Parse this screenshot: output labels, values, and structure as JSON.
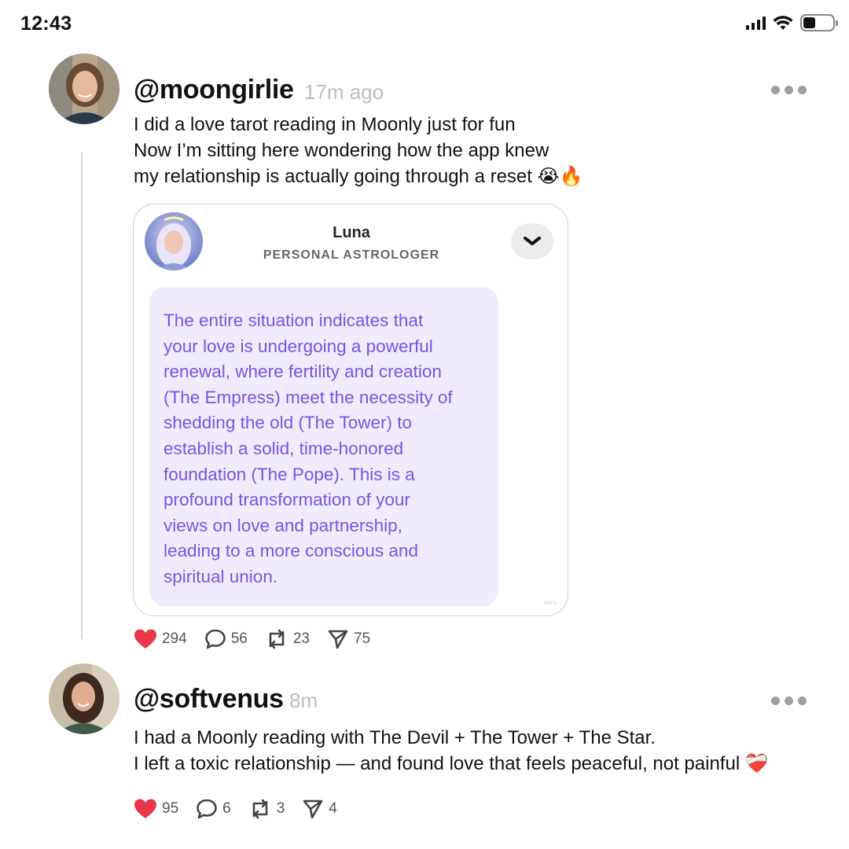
{
  "status_bar": {
    "time": "12:43"
  },
  "posts": [
    {
      "handle": "@moongirlie",
      "time": "17m ago",
      "lines": [
        "I did a love tarot reading in Moonly just for fun",
        "Now I’m sitting here wondering how the app knew",
        "my relationship is actually going through a reset 😭🔥"
      ],
      "card": {
        "name": "Luna",
        "role": "PERSONAL ASTROLOGER",
        "message_lines": [
          "The entire situation indicates that",
          "your love is undergoing a powerful",
          "renewal, where fertility and creation",
          "(The Empress) meet the necessity of",
          "shedding the old (The Tower) to",
          "establish a solid, time-honored",
          "foundation (The Pope). This is a",
          "profound transformation of your",
          "views on love and partnership,",
          "leading to a more conscious and",
          "spiritual union."
        ],
        "watermark": "miro"
      },
      "stats": {
        "likes": "294",
        "comments": "56",
        "reposts": "23",
        "shares": "75"
      }
    },
    {
      "handle": "@softvenus",
      "time": "8m",
      "lines": [
        "I had a Moonly reading with The Devil + The Tower + The Star.",
        "I left a toxic relationship — and found love that feels peaceful, not painful ❤️‍🩹"
      ],
      "stats": {
        "likes": "95",
        "comments": "6",
        "reposts": "3",
        "shares": "4"
      }
    }
  ],
  "icons": [
    "heart-icon",
    "comment-icon",
    "repost-icon",
    "share-icon",
    "more-icon",
    "chevron-down-icon",
    "signal-icon",
    "wifi-icon",
    "battery-icon"
  ],
  "colors": {
    "like": "#e8394a",
    "bubble_bg": "#f1ecfd",
    "bubble_text": "#7a52e3"
  }
}
